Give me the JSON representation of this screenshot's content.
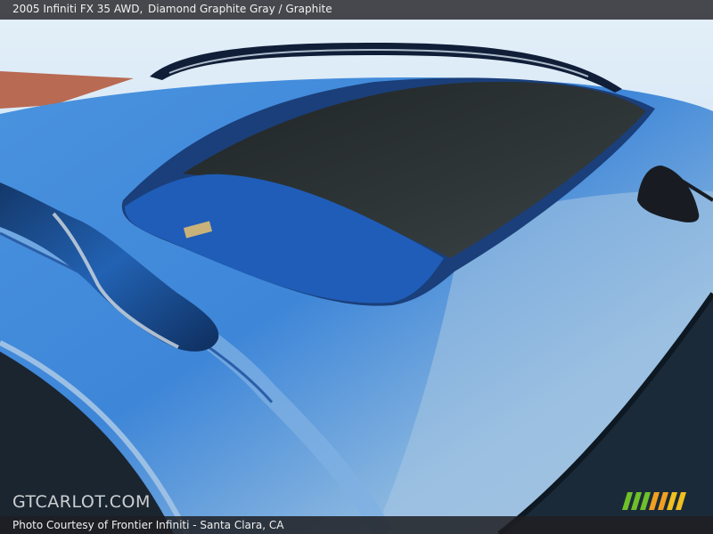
{
  "header": {
    "vehicle": "2005 Infiniti FX 35 AWD,",
    "color": "Diamond Graphite Gray / Graphite"
  },
  "footer": {
    "credit": "Photo Courtesy of Frontier Infiniti - Santa Clara, CA"
  },
  "watermark": {
    "logo_text": "GTCARLOT.COM"
  },
  "colors": {
    "roof_blue": "#3f86d6",
    "sky": "#cfe4f4",
    "wall": "#b86a52",
    "sunroof_glass": "#2b3132",
    "stripe_green": "#6fbf2a",
    "stripe_orange": "#f0a020"
  }
}
